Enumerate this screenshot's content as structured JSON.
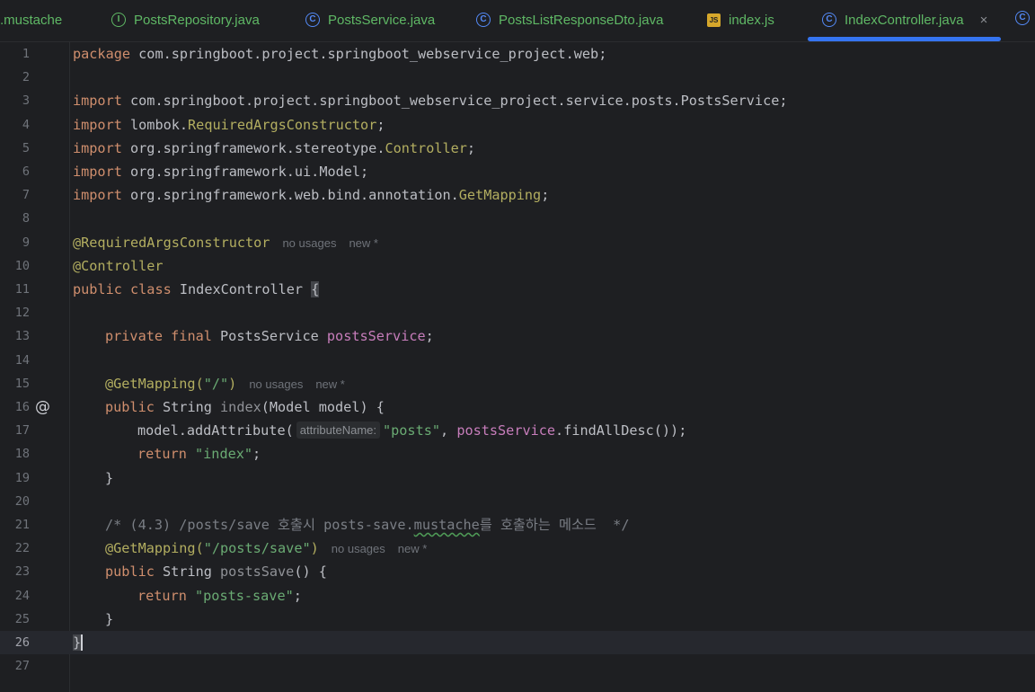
{
  "tabs": [
    {
      "label": ".mustache"
    },
    {
      "label": "PostsRepository.java",
      "icon": "interface-icon"
    },
    {
      "label": "PostsService.java",
      "icon": "class-icon"
    },
    {
      "label": "PostsListResponseDto.java",
      "icon": "class-icon"
    },
    {
      "label": "index.js",
      "icon": "js-file-icon",
      "icon_text": "JS"
    },
    {
      "label": "IndexController.java",
      "icon": "class-icon",
      "active": true
    }
  ],
  "icons": {
    "class_glyph": "C",
    "interface_glyph": "I",
    "close_glyph": "×",
    "override_glyph": "@"
  },
  "colors": {
    "keyword": "#cf8e6d",
    "annotation": "#b3ae60",
    "string": "#6aab73",
    "field": "#c77dbb",
    "comment": "#7a7e85",
    "tab_accent": "#3574f0"
  },
  "editor": {
    "current_line": 26,
    "lines": [
      {
        "n": "1"
      },
      {
        "n": "2"
      },
      {
        "n": "3"
      },
      {
        "n": "4"
      },
      {
        "n": "5"
      },
      {
        "n": "6"
      },
      {
        "n": "7"
      },
      {
        "n": "8"
      },
      {
        "n": "9"
      },
      {
        "n": "10"
      },
      {
        "n": "11"
      },
      {
        "n": "12"
      },
      {
        "n": "13"
      },
      {
        "n": "14"
      },
      {
        "n": "15"
      },
      {
        "n": "16"
      },
      {
        "n": "17"
      },
      {
        "n": "18"
      },
      {
        "n": "19"
      },
      {
        "n": "20"
      },
      {
        "n": "21"
      },
      {
        "n": "22"
      },
      {
        "n": "23"
      },
      {
        "n": "24"
      },
      {
        "n": "25"
      },
      {
        "n": "26"
      },
      {
        "n": "27"
      }
    ],
    "t": {
      "package": "package",
      "pkg_name": " com.springboot.project.springboot_webservice_project.web;",
      "import": "import",
      "imp3": " com.springboot.project.springboot_webservice_project.service.posts.PostsService;",
      "imp4a": " lombok.",
      "imp4b": "RequiredArgsConstructor",
      "imp4c": ";",
      "imp5a": " org.springframework.stereotype.",
      "imp5b": "Controller",
      "imp5c": ";",
      "imp6": " org.springframework.ui.Model;",
      "imp7a": " org.springframework.web.bind.annotation.",
      "imp7b": "GetMapping",
      "imp7c": ";",
      "ann_rac": "@RequiredArgsConstructor",
      "no_usages": "no usages",
      "new_star": "new *",
      "ann_ctrl": "@Controller",
      "public": "public",
      "class": " class",
      "cls_name": " IndexController ",
      "lbrace": "{",
      "private": "private",
      "final": " final",
      "svc_type": " PostsService ",
      "svc_field": "postsService",
      "semi": ";",
      "ann_get": "@GetMapping(",
      "root_path": "\"/\"",
      "rparen": ")",
      "string_type": " String ",
      "m_index": "index",
      "index_params": "(Model model) {",
      "model_add": "model.addAttribute(",
      "param_hint": "attributeName:",
      "posts_str": "\"posts\"",
      "comma": ", ",
      "find_all": ".findAllDesc());",
      "return": "return",
      "index_str": " \"index\"",
      "rbrace": "}",
      "comment_a": "/* (4.3) /posts/save 호출시 posts-save.",
      "comment_b": "mustache",
      "comment_c": "를 호출하는 메소드  */",
      "save_path": "\"/posts/save\"",
      "m_save": "postsSave",
      "save_params": "() {",
      "save_str": " \"posts-save\""
    }
  }
}
